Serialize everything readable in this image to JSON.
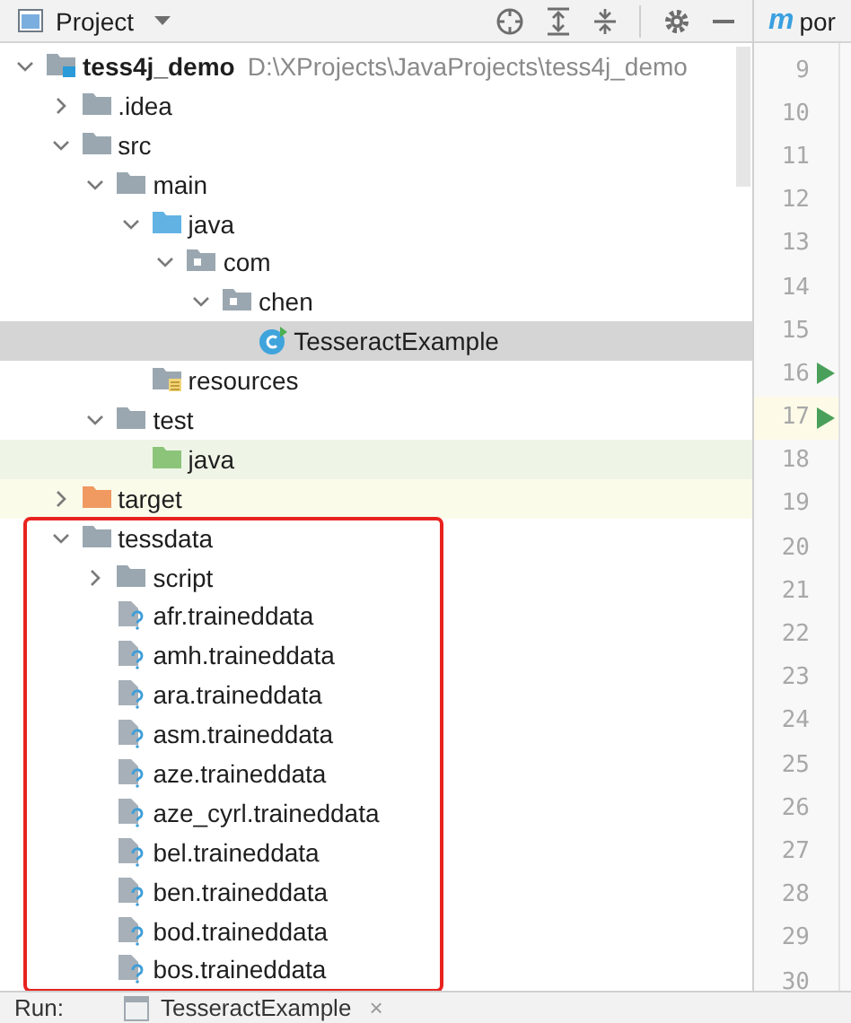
{
  "project_panel": {
    "title": "Project"
  },
  "editor_tab": {
    "icon_letter": "m",
    "label": "por"
  },
  "tree": {
    "label": "tess4j_demo",
    "path": "D:\\XProjects\\JavaProjects\\tess4j_demo",
    "kind": "module",
    "expanded": true,
    "selected": false,
    "children": [
      {
        "label": ".idea",
        "kind": "folder",
        "expanded": false,
        "selected": false
      },
      {
        "label": "src",
        "kind": "folder",
        "expanded": true,
        "selected": false,
        "children": [
          {
            "label": "main",
            "kind": "folder",
            "expanded": true,
            "selected": false,
            "children": [
              {
                "label": "java",
                "kind": "source_folder",
                "expanded": true,
                "selected": false,
                "children": [
                  {
                    "label": "com",
                    "kind": "package",
                    "expanded": true,
                    "selected": false,
                    "children": [
                      {
                        "label": "chen",
                        "kind": "package",
                        "expanded": true,
                        "selected": false,
                        "children": [
                          {
                            "label": "TesseractExample",
                            "kind": "class",
                            "selected": true
                          }
                        ]
                      }
                    ]
                  }
                ]
              },
              {
                "label": "resources",
                "kind": "resources",
                "selected": false
              }
            ]
          },
          {
            "label": "test",
            "kind": "folder",
            "expanded": true,
            "selected": false,
            "children": [
              {
                "label": "java",
                "kind": "test_folder",
                "selected": false,
                "color": "#eef5e7"
              }
            ]
          }
        ]
      },
      {
        "label": "target",
        "kind": "excluded_folder",
        "expanded": false,
        "selected": false,
        "color": "#fbfbea"
      },
      {
        "label": "tessdata",
        "kind": "folder",
        "expanded": true,
        "selected": false,
        "outlined": true,
        "children": [
          {
            "label": "script",
            "kind": "folder",
            "expanded": false,
            "selected": false
          },
          {
            "label": "afr.traineddata",
            "kind": "unknown_file",
            "selected": false
          },
          {
            "label": "amh.traineddata",
            "kind": "unknown_file",
            "selected": false
          },
          {
            "label": "ara.traineddata",
            "kind": "unknown_file",
            "selected": false
          },
          {
            "label": "asm.traineddata",
            "kind": "unknown_file",
            "selected": false
          },
          {
            "label": "aze.traineddata",
            "kind": "unknown_file",
            "selected": false
          },
          {
            "label": "aze_cyrl.traineddata",
            "kind": "unknown_file",
            "selected": false
          },
          {
            "label": "bel.traineddata",
            "kind": "unknown_file",
            "selected": false
          },
          {
            "label": "ben.traineddata",
            "kind": "unknown_file",
            "selected": false
          },
          {
            "label": "bod.traineddata",
            "kind": "unknown_file",
            "selected": false
          },
          {
            "label": "bos.traineddata",
            "kind": "unknown_file",
            "selected": false
          }
        ]
      }
    ]
  },
  "gutter": {
    "lines": [
      {
        "number": "9",
        "run_marker": false,
        "current": false
      },
      {
        "number": "10",
        "run_marker": false,
        "current": false
      },
      {
        "number": "11",
        "run_marker": false,
        "current": false
      },
      {
        "number": "12",
        "run_marker": false,
        "current": false
      },
      {
        "number": "13",
        "run_marker": false,
        "current": false
      },
      {
        "number": "14",
        "run_marker": false,
        "current": false
      },
      {
        "number": "15",
        "run_marker": false,
        "current": false
      },
      {
        "number": "16",
        "run_marker": true,
        "current": false
      },
      {
        "number": "17",
        "run_marker": true,
        "current": true
      },
      {
        "number": "18",
        "run_marker": false,
        "current": false
      },
      {
        "number": "19",
        "run_marker": false,
        "current": false
      },
      {
        "number": "20",
        "run_marker": false,
        "current": false
      },
      {
        "number": "21",
        "run_marker": false,
        "current": false
      },
      {
        "number": "22",
        "run_marker": false,
        "current": false
      },
      {
        "number": "23",
        "run_marker": false,
        "current": false
      },
      {
        "number": "24",
        "run_marker": false,
        "current": false
      },
      {
        "number": "25",
        "run_marker": false,
        "current": false
      },
      {
        "number": "26",
        "run_marker": false,
        "current": false
      },
      {
        "number": "27",
        "run_marker": false,
        "current": false
      },
      {
        "number": "28",
        "run_marker": false,
        "current": false
      },
      {
        "number": "29",
        "run_marker": false,
        "current": false
      },
      {
        "number": "30",
        "run_marker": false,
        "current": false
      }
    ]
  },
  "run_bar": {
    "label": "Run:",
    "tabs": [
      {
        "label": "TesseractExample",
        "close": "×"
      }
    ]
  }
}
